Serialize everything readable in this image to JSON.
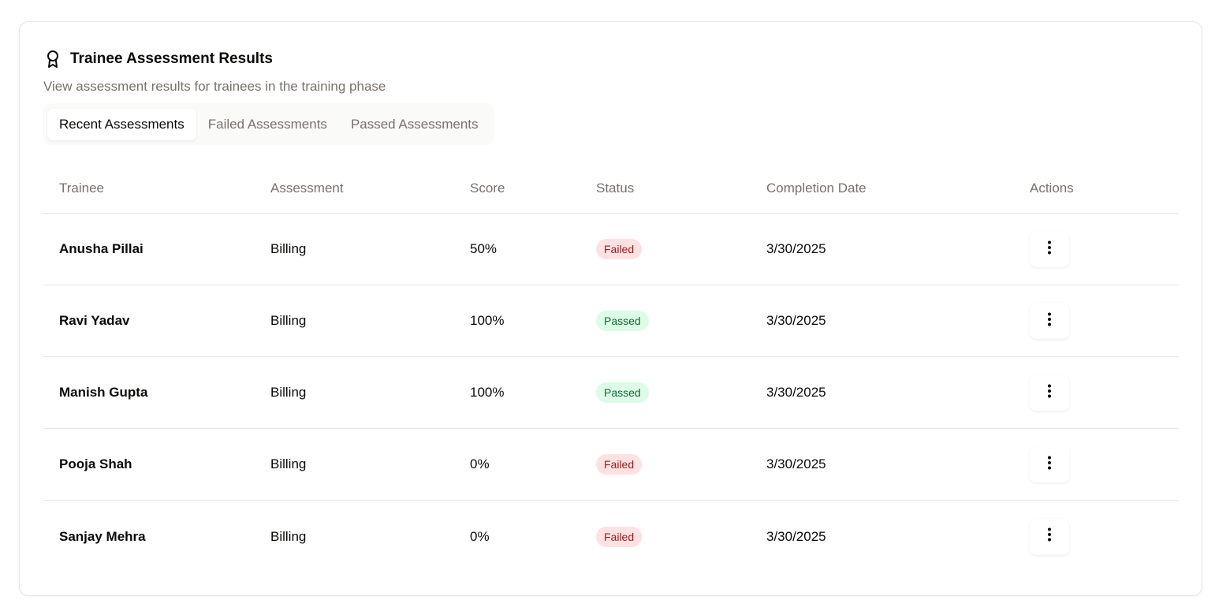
{
  "header": {
    "title": "Trainee Assessment Results",
    "subtitle": "View assessment results for trainees in the training phase",
    "icon": "award-icon"
  },
  "tabs": [
    {
      "label": "Recent Assessments",
      "active": true
    },
    {
      "label": "Failed Assessments",
      "active": false
    },
    {
      "label": "Passed Assessments",
      "active": false
    }
  ],
  "table": {
    "columns": [
      "Trainee",
      "Assessment",
      "Score",
      "Status",
      "Completion Date",
      "Actions"
    ],
    "rows": [
      {
        "trainee": "Anusha Pillai",
        "assessment": "Billing",
        "score": "50%",
        "status": "Failed",
        "date": "3/30/2025"
      },
      {
        "trainee": "Ravi Yadav",
        "assessment": "Billing",
        "score": "100%",
        "status": "Passed",
        "date": "3/30/2025"
      },
      {
        "trainee": "Manish Gupta",
        "assessment": "Billing",
        "score": "100%",
        "status": "Passed",
        "date": "3/30/2025"
      },
      {
        "trainee": "Pooja Shah",
        "assessment": "Billing",
        "score": "0%",
        "status": "Failed",
        "date": "3/30/2025"
      },
      {
        "trainee": "Sanjay Mehra",
        "assessment": "Billing",
        "score": "0%",
        "status": "Failed",
        "date": "3/30/2025"
      }
    ]
  },
  "colors": {
    "failed_bg": "#fee2e2",
    "failed_text": "#991b1b",
    "passed_bg": "#dcfce7",
    "passed_text": "#166534",
    "muted_text": "#78716c",
    "border": "#e7e5e4"
  }
}
